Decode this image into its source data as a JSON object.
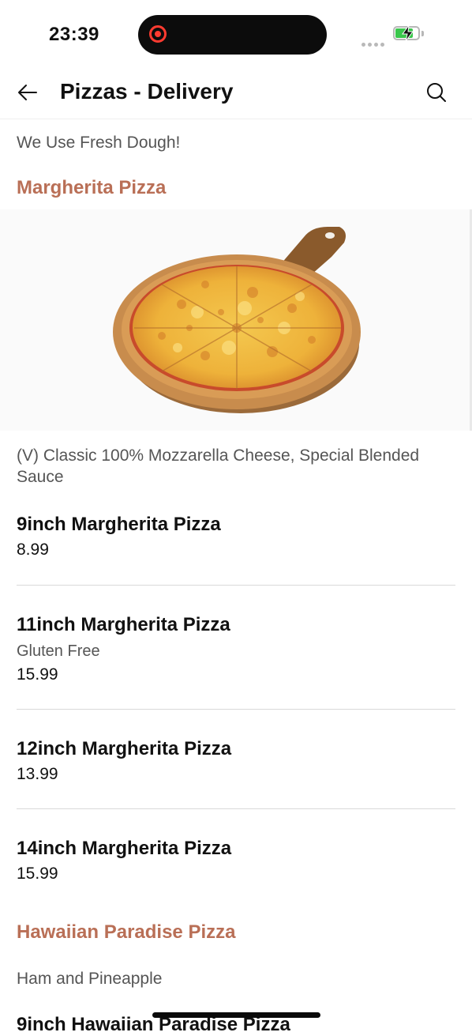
{
  "status": {
    "time": "23:39"
  },
  "header": {
    "title": "Pizzas - Delivery"
  },
  "tagline": "We Use Fresh Dough!",
  "sections": [
    {
      "title": "Margherita Pizza",
      "description": "(V) Classic 100% Mozzarella Cheese, Special Blended Sauce",
      "items": [
        {
          "name": "9inch Margherita Pizza",
          "price": "8.99"
        },
        {
          "name": "11inch Margherita Pizza",
          "note": "Gluten Free",
          "price": "15.99"
        },
        {
          "name": "12inch Margherita Pizza",
          "price": "13.99"
        },
        {
          "name": "14inch Margherita Pizza",
          "price": "15.99"
        }
      ]
    },
    {
      "title": "Hawaiian Paradise Pizza",
      "description": "Ham and Pineapple",
      "items": [
        {
          "name": "9inch Hawaiian Paradise Pizza"
        }
      ]
    }
  ],
  "icons": {
    "back": "arrow-left-icon",
    "search": "search-icon",
    "recording": "screen-recording-icon",
    "battery": "battery-charging-icon"
  },
  "colors": {
    "accent": "#b96f56",
    "text": "#111111",
    "muted": "#555555",
    "divider": "#d9d9d9",
    "battery": "#3ac74c"
  },
  "battery_level": 0.8
}
